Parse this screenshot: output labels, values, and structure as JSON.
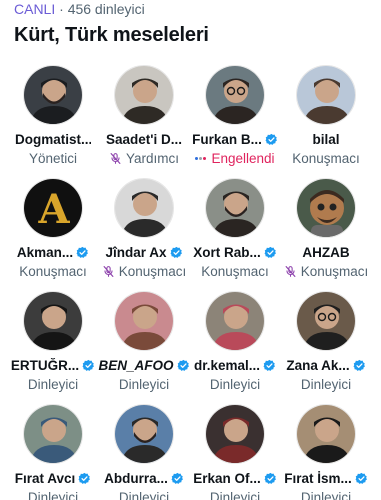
{
  "space": {
    "live_label": "CANLI",
    "separator": "·",
    "listeners": "456 dinleyici",
    "title": "Kürt, Türk meseleleri"
  },
  "colors": {
    "live": "#6b5cd6",
    "verified": "#1d9bf0",
    "blocked": "#e0245e",
    "muted_icon": "#8e44ad",
    "role_text": "#536471"
  },
  "participants": [
    [
      {
        "name": "Dogmatist...",
        "verified": false,
        "role": "Yönetici",
        "muted": false,
        "avatar": {
          "bg": "#3a3f45",
          "fg": "#1b1d20",
          "icon": "person-masked"
        }
      },
      {
        "name": "Saadet'i D...",
        "verified": false,
        "role": "Yardımcı",
        "muted": true,
        "avatar": {
          "bg": "#c9c6c0",
          "fg": "#2e2a25",
          "icon": "person-elder"
        }
      },
      {
        "name": "Furkan B...",
        "verified": true,
        "role": "Engellendi",
        "muted": false,
        "blocked": true,
        "avatar": {
          "bg": "#6b7a80",
          "fg": "#2b2522",
          "icon": "person-glasses"
        }
      },
      {
        "name": "bilal",
        "verified": false,
        "role": "Konuşmacı",
        "muted": false,
        "avatar": {
          "bg": "#b9c7d8",
          "fg": "#4a3a30",
          "icon": "person-city"
        }
      }
    ],
    [
      {
        "name": "Akman...",
        "verified": true,
        "role": "Konuşmacı",
        "muted": false,
        "avatar": {
          "bg": "#101010",
          "fg": "#d9a52b",
          "icon": "letter-a"
        }
      },
      {
        "name": "Jîndar Ax",
        "verified": true,
        "role": "Konuşmacı",
        "muted": true,
        "avatar": {
          "bg": "#d8d8d8",
          "fg": "#2a2a2a",
          "icon": "person-bw"
        }
      },
      {
        "name": "Xort Rab...",
        "verified": true,
        "role": "Konuşmacı",
        "muted": false,
        "avatar": {
          "bg": "#8a8f88",
          "fg": "#2a2522",
          "icon": "person-beard"
        }
      },
      {
        "name": "AHZAB",
        "verified": false,
        "role": "Konuşmacı",
        "muted": true,
        "avatar": {
          "bg": "#4a5a4a",
          "fg": "#b07b4e",
          "icon": "cartoon-face"
        }
      }
    ],
    [
      {
        "name": "ERTUĞR...",
        "verified": true,
        "role": "Dinleyici",
        "muted": false,
        "avatar": {
          "bg": "#3c3c3c",
          "fg": "#151515",
          "icon": "person-selfie"
        }
      },
      {
        "name": "BEN_AFOO",
        "verified": true,
        "role": "Dinleyici",
        "muted": false,
        "italic": true,
        "avatar": {
          "bg": "#c98a8f",
          "fg": "#7a4a3a",
          "icon": "person-hair"
        }
      },
      {
        "name": "dr.kemal...",
        "verified": true,
        "role": "Dinleyici",
        "muted": false,
        "avatar": {
          "bg": "#8c8478",
          "fg": "#b94a5a",
          "icon": "person-scarf"
        }
      },
      {
        "name": "Zana Ak...",
        "verified": true,
        "role": "Dinleyici",
        "muted": false,
        "avatar": {
          "bg": "#6a5a4a",
          "fg": "#1f1f1f",
          "icon": "person-glasses"
        }
      }
    ],
    [
      {
        "name": "Fırat Avcı",
        "verified": true,
        "role": "Dinleyici",
        "muted": false,
        "avatar": {
          "bg": "#7d8f86",
          "fg": "#3a5a7a",
          "icon": "person-shirt"
        }
      },
      {
        "name": "Abdurra...",
        "verified": true,
        "role": "Dinleyici",
        "muted": false,
        "avatar": {
          "bg": "#5a7fa8",
          "fg": "#2a2a2a",
          "icon": "person-beard"
        }
      },
      {
        "name": "Erkan Of...",
        "verified": true,
        "role": "Dinleyici",
        "muted": false,
        "avatar": {
          "bg": "#3a3030",
          "fg": "#7a2a2a",
          "icon": "person-red"
        }
      },
      {
        "name": "Fırat İsm...",
        "verified": true,
        "role": "Dinleyici",
        "muted": false,
        "avatar": {
          "bg": "#a58e74",
          "fg": "#1a1a1a",
          "icon": "person-smile"
        }
      }
    ]
  ]
}
